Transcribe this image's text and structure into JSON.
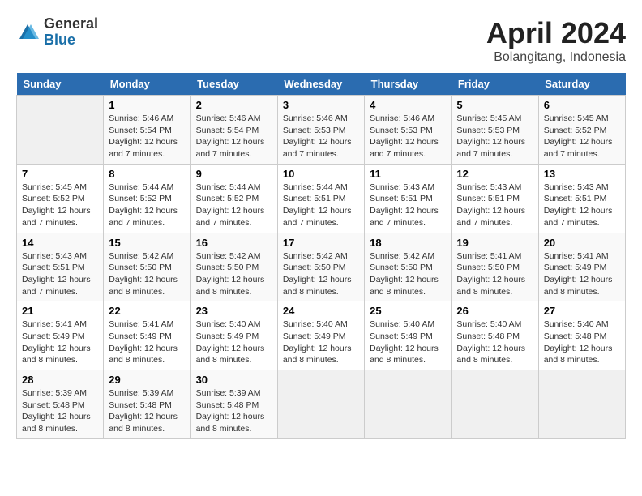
{
  "header": {
    "logo_general": "General",
    "logo_blue": "Blue",
    "title": "April 2024",
    "subtitle": "Bolangitang, Indonesia"
  },
  "calendar": {
    "days_of_week": [
      "Sunday",
      "Monday",
      "Tuesday",
      "Wednesday",
      "Thursday",
      "Friday",
      "Saturday"
    ],
    "weeks": [
      [
        {
          "day": "",
          "info": ""
        },
        {
          "day": "1",
          "info": "Sunrise: 5:46 AM\nSunset: 5:54 PM\nDaylight: 12 hours\nand 7 minutes."
        },
        {
          "day": "2",
          "info": "Sunrise: 5:46 AM\nSunset: 5:54 PM\nDaylight: 12 hours\nand 7 minutes."
        },
        {
          "day": "3",
          "info": "Sunrise: 5:46 AM\nSunset: 5:53 PM\nDaylight: 12 hours\nand 7 minutes."
        },
        {
          "day": "4",
          "info": "Sunrise: 5:46 AM\nSunset: 5:53 PM\nDaylight: 12 hours\nand 7 minutes."
        },
        {
          "day": "5",
          "info": "Sunrise: 5:45 AM\nSunset: 5:53 PM\nDaylight: 12 hours\nand 7 minutes."
        },
        {
          "day": "6",
          "info": "Sunrise: 5:45 AM\nSunset: 5:52 PM\nDaylight: 12 hours\nand 7 minutes."
        }
      ],
      [
        {
          "day": "7",
          "info": ""
        },
        {
          "day": "8",
          "info": "Sunrise: 5:44 AM\nSunset: 5:52 PM\nDaylight: 12 hours\nand 7 minutes."
        },
        {
          "day": "9",
          "info": "Sunrise: 5:44 AM\nSunset: 5:52 PM\nDaylight: 12 hours\nand 7 minutes."
        },
        {
          "day": "10",
          "info": "Sunrise: 5:44 AM\nSunset: 5:51 PM\nDaylight: 12 hours\nand 7 minutes."
        },
        {
          "day": "11",
          "info": "Sunrise: 5:43 AM\nSunset: 5:51 PM\nDaylight: 12 hours\nand 7 minutes."
        },
        {
          "day": "12",
          "info": "Sunrise: 5:43 AM\nSunset: 5:51 PM\nDaylight: 12 hours\nand 7 minutes."
        },
        {
          "day": "13",
          "info": "Sunrise: 5:43 AM\nSunset: 5:51 PM\nDaylight: 12 hours\nand 7 minutes."
        }
      ],
      [
        {
          "day": "14",
          "info": ""
        },
        {
          "day": "15",
          "info": "Sunrise: 5:42 AM\nSunset: 5:50 PM\nDaylight: 12 hours\nand 8 minutes."
        },
        {
          "day": "16",
          "info": "Sunrise: 5:42 AM\nSunset: 5:50 PM\nDaylight: 12 hours\nand 8 minutes."
        },
        {
          "day": "17",
          "info": "Sunrise: 5:42 AM\nSunset: 5:50 PM\nDaylight: 12 hours\nand 8 minutes."
        },
        {
          "day": "18",
          "info": "Sunrise: 5:42 AM\nSunset: 5:50 PM\nDaylight: 12 hours\nand 8 minutes."
        },
        {
          "day": "19",
          "info": "Sunrise: 5:41 AM\nSunset: 5:50 PM\nDaylight: 12 hours\nand 8 minutes."
        },
        {
          "day": "20",
          "info": "Sunrise: 5:41 AM\nSunset: 5:49 PM\nDaylight: 12 hours\nand 8 minutes."
        }
      ],
      [
        {
          "day": "21",
          "info": ""
        },
        {
          "day": "22",
          "info": "Sunrise: 5:41 AM\nSunset: 5:49 PM\nDaylight: 12 hours\nand 8 minutes."
        },
        {
          "day": "23",
          "info": "Sunrise: 5:40 AM\nSunset: 5:49 PM\nDaylight: 12 hours\nand 8 minutes."
        },
        {
          "day": "24",
          "info": "Sunrise: 5:40 AM\nSunset: 5:49 PM\nDaylight: 12 hours\nand 8 minutes."
        },
        {
          "day": "25",
          "info": "Sunrise: 5:40 AM\nSunset: 5:49 PM\nDaylight: 12 hours\nand 8 minutes."
        },
        {
          "day": "26",
          "info": "Sunrise: 5:40 AM\nSunset: 5:48 PM\nDaylight: 12 hours\nand 8 minutes."
        },
        {
          "day": "27",
          "info": "Sunrise: 5:40 AM\nSunset: 5:48 PM\nDaylight: 12 hours\nand 8 minutes."
        }
      ],
      [
        {
          "day": "28",
          "info": "Sunrise: 5:39 AM\nSunset: 5:48 PM\nDaylight: 12 hours\nand 8 minutes."
        },
        {
          "day": "29",
          "info": "Sunrise: 5:39 AM\nSunset: 5:48 PM\nDaylight: 12 hours\nand 8 minutes."
        },
        {
          "day": "30",
          "info": "Sunrise: 5:39 AM\nSunset: 5:48 PM\nDaylight: 12 hours\nand 8 minutes."
        },
        {
          "day": "",
          "info": ""
        },
        {
          "day": "",
          "info": ""
        },
        {
          "day": "",
          "info": ""
        },
        {
          "day": "",
          "info": ""
        }
      ]
    ],
    "week1_sunday_info": "Sunrise: 5:46 AM\nSunset: 5:54 PM\nDaylight: 12 hours\nand 7 minutes.",
    "week2_sunday_info": "Sunrise: 5:45 AM\nSunset: 5:52 PM\nDaylight: 12 hours\nand 7 minutes.",
    "week3_sunday_info": "Sunrise: 5:43 AM\nSunset: 5:51 PM\nDaylight: 12 hours\nand 7 minutes.",
    "week4_sunday_info": "Sunrise: 5:42 AM\nSunset: 5:50 PM\nDaylight: 12 hours\nand 8 minutes.",
    "week5_sunday_info": "Sunrise: 5:41 AM\nSunset: 5:49 PM\nDaylight: 12 hours\nand 8 minutes."
  }
}
